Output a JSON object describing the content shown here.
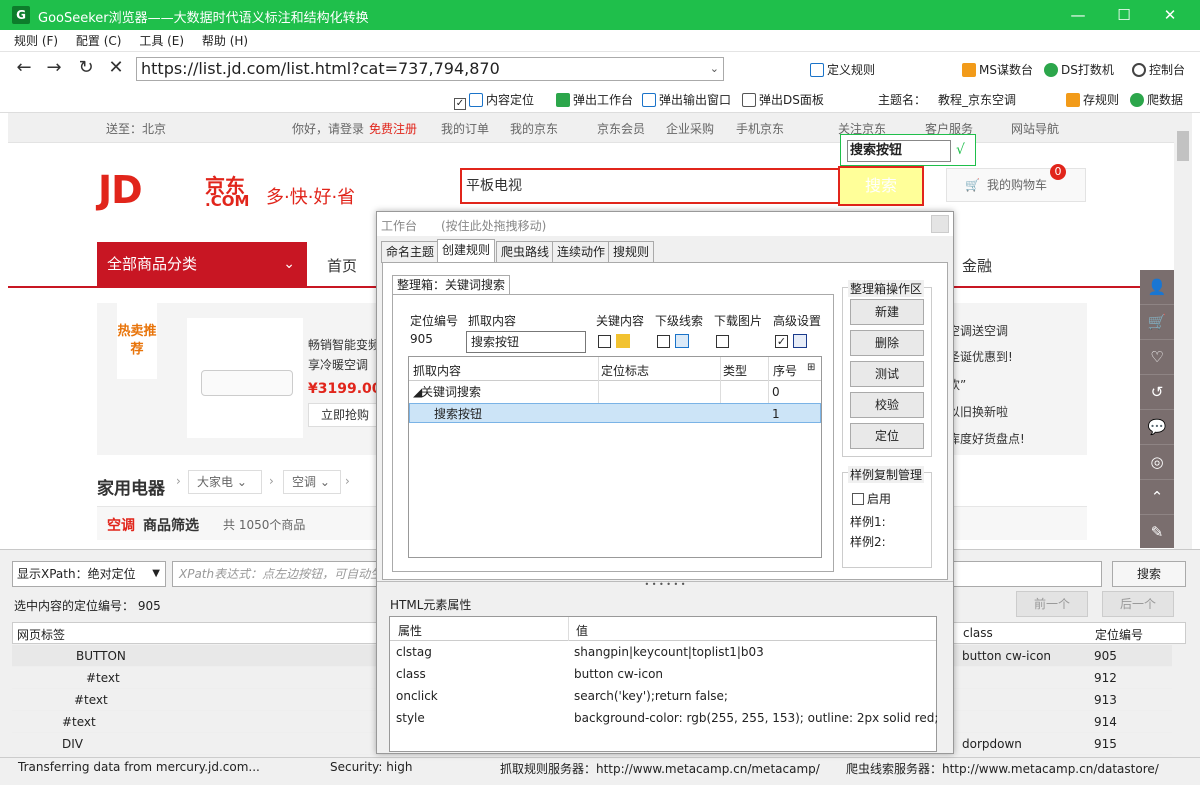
{
  "window": {
    "icon": "G",
    "title": "GooSeeker浏览器——大数据时代语义标注和结构化转换",
    "min": "—",
    "max": "☐",
    "close": "✕"
  },
  "menu": [
    "规则 (F)",
    "配置 (C)",
    "工具 (E)",
    "帮助 (H)"
  ],
  "nav": {
    "url": "https://list.jd.com/list.html?cat=737,794,870",
    "define_rule": "定义规则",
    "ms": "MS谋数台",
    "ds": "DS打数机",
    "console": "控制台"
  },
  "toolbar2": {
    "content_locate": "内容定位",
    "popup_workbench": "弹出工作台",
    "popup_output": "弹出输出窗口",
    "popup_ds": "弹出DS面板",
    "theme_label": "主题名：",
    "theme_value": "教程_京东空调",
    "save_rule": "存规则",
    "crawl": "爬数据"
  },
  "jd": {
    "top": {
      "ship": "送至：北京",
      "greet": "你好，请登录",
      "register": "免费注册",
      "orders": "我的订单",
      "myjd": "我的京东",
      "member": "京东会员",
      "enterprise": "企业采购",
      "mobile": "手机京东",
      "follow": "关注京东",
      "service": "客户服务",
      "sitenav": "网站导航"
    },
    "logo_jd": "JD",
    "logo_cn": "京东",
    "logo_com": ".COM",
    "slogan": "多·快·好·省",
    "search_text": "平板电视",
    "search_btn": "搜索",
    "cart": "我的购物车",
    "cart_count": "0",
    "category": "全部商品分类",
    "nav_home": "首页",
    "nav_finance": "金融",
    "promo": {
      "tag": "热卖推荐",
      "title": "畅销智能变频",
      "sub": "享冷暖空调（",
      "price": "¥3199.00",
      "buy": "立即抢购"
    },
    "right_promos": [
      "空调送空调",
      "圣诞优惠到!",
      "欢”",
      "以旧换新啦",
      "库度好货盘点!"
    ],
    "appliance": "家用电器",
    "crumb1": "大家电",
    "crumb2": "空调",
    "filter": {
      "t1": "空调",
      "t2": "商品筛选",
      "t3": "共 1050个商品"
    }
  },
  "tooltip": {
    "value": "搜索按钮",
    "check": "√"
  },
  "workpanel": {
    "title": "工作台",
    "hint": "(按住此处拖拽移动)",
    "tabs": [
      "命名主题",
      "创建规则",
      "爬虫路线",
      "连续动作",
      "搜规则"
    ],
    "box_label": "整理箱：关键词搜索",
    "labels": {
      "loc_num": "定位编号",
      "grab": "抓取内容",
      "key": "关键内容",
      "sub": "下级线索",
      "img": "下载图片",
      "adv": "高级设置"
    },
    "loc_num": "905",
    "grab_value": "搜索按钮",
    "grid_cols": [
      "抓取内容",
      "定位标志",
      "类型",
      "序号"
    ],
    "grid_rows": [
      {
        "name": "关键词搜索",
        "seq": "0"
      },
      {
        "name": "搜索按钮",
        "seq": "1"
      }
    ],
    "ops_title": "整理箱操作区",
    "ops": [
      "新建",
      "删除",
      "测试",
      "校验",
      "定位"
    ],
    "copy_title": "样例复制管理",
    "enable": "启用",
    "sample1": "样例1:",
    "sample2": "样例2:",
    "html_title": "HTML元素属性",
    "html_cols": [
      "属性",
      "值"
    ],
    "html_rows": [
      {
        "k": "clstag",
        "v": "shangpin|keycount|toplist1|b03"
      },
      {
        "k": "class",
        "v": "button cw-icon"
      },
      {
        "k": "onclick",
        "v": "search('key');return false;"
      },
      {
        "k": "style",
        "v": "background-color: rgb(255, 255, 153); outline: 2px solid red;"
      }
    ]
  },
  "bottom": {
    "xpath_mode": "显示XPath：绝对定位",
    "xpath_placeholder": "XPath表达式：点左边按钮，可自动生",
    "search": "搜索",
    "sel_label": "选中内容的定位编号：",
    "sel_num": "905",
    "prev": "前一个",
    "next": "后一个",
    "tree_cols": {
      "tag": "网页标签",
      "cls": "class",
      "num": "定位编号"
    },
    "tree_rows": [
      {
        "tag": "BUTTON",
        "cls": "button cw-icon",
        "num": "905"
      },
      {
        "tag": "#text",
        "cls": "",
        "num": "912"
      },
      {
        "tag": "#text",
        "cls": "",
        "num": "913"
      },
      {
        "tag": "#text",
        "cls": "",
        "num": "914"
      },
      {
        "tag": "DIV",
        "cls": "dorpdown",
        "num": "915"
      }
    ]
  },
  "status": {
    "left": "Transferring data from mercury.jd.com...",
    "security": "Security: high",
    "server1": "抓取规则服务器：http://www.metacamp.cn/metacamp/",
    "server2": "爬虫线索服务器：http://www.metacamp.cn/datastore/"
  },
  "colors": {
    "titlebar": "#1fbf4b",
    "jd_red": "#e1251b",
    "jd_dark_red": "#c81623",
    "search_highlight": "#ffff99"
  }
}
